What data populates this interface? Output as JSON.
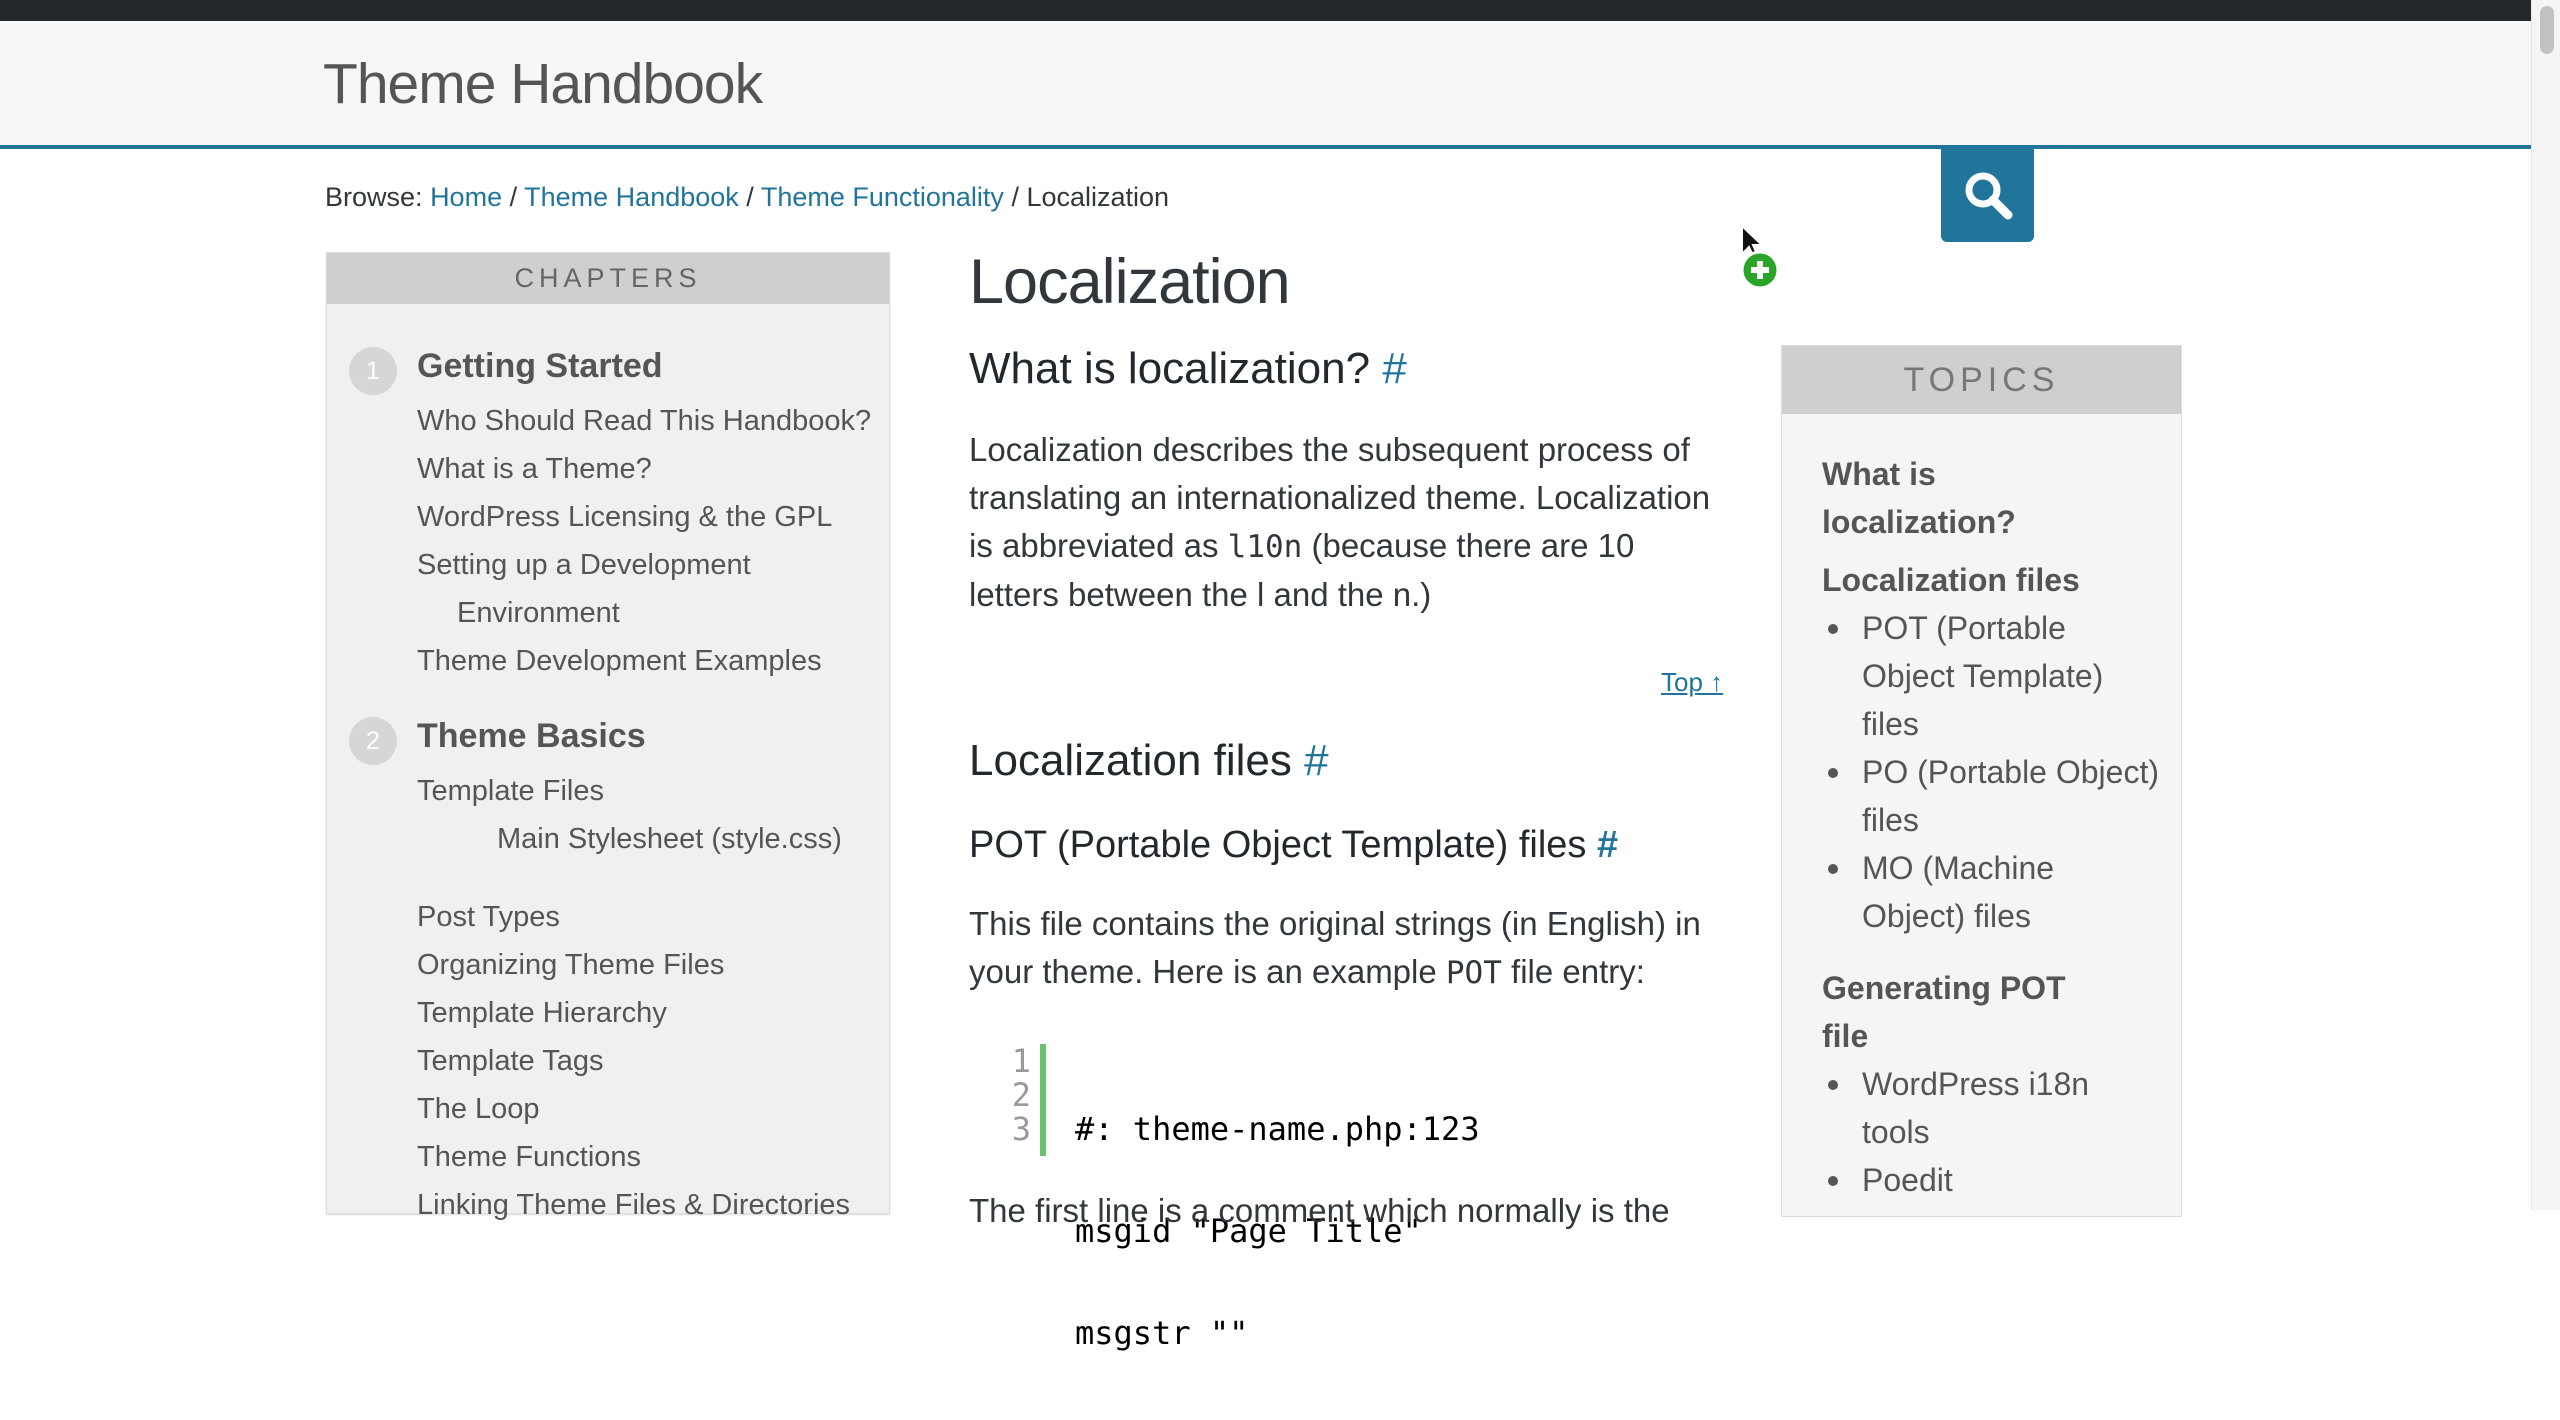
{
  "header": {
    "site_title": "Theme Handbook"
  },
  "breadcrumb": {
    "prefix": "Browse:",
    "items": [
      {
        "label": "Home"
      },
      {
        "label": "Theme Handbook"
      },
      {
        "label": "Theme Functionality"
      }
    ],
    "current": "Localization",
    "separator": "/"
  },
  "search": {
    "icon": "search-icon"
  },
  "chapters": {
    "heading": "CHAPTERS",
    "groups": [
      {
        "num": "1",
        "title": "Getting Started",
        "items": [
          "Who Should Read This Handbook?",
          "What is a Theme?",
          "WordPress Licensing & the GPL",
          "Setting up a Development",
          "Environment",
          "Theme Development Examples"
        ]
      },
      {
        "num": "2",
        "title": "Theme Basics",
        "items": [
          "Template Files",
          "Main Stylesheet (style.css)",
          "Post Types",
          "Organizing Theme Files",
          "Template Hierarchy",
          "Template Tags",
          "The Loop",
          "Theme Functions",
          "Linking Theme Files & Directories"
        ]
      }
    ]
  },
  "article": {
    "title": "Localization",
    "anchor": "#",
    "s1": {
      "heading": "What is localization?",
      "p1": "Localization describes the subsequent process of translating an internationalized theme. Localization is abbreviated as ",
      "code": "l10n",
      "p2": " (because there are 10 letters between the l and the n.)"
    },
    "top_link": "Top ↑",
    "s2": {
      "heading": "Localization files"
    },
    "s3": {
      "heading": "POT (Portable Object Template) files",
      "p1": "This file contains the original strings (in English) in your theme. Here is an example ",
      "code": "POT",
      "p2": " file entry:"
    },
    "code_block": {
      "line_numbers": [
        "1",
        "2",
        "3"
      ],
      "lines": [
        "#: theme-name.php:123",
        "msgid \"Page Title\"",
        "msgstr \"\""
      ]
    },
    "cut_text": "The first line is a comment which normally is the"
  },
  "topics": {
    "heading": "TOPICS",
    "t1": "What is localization?",
    "t2": "Localization files",
    "t2_items": [
      "POT (Portable Object Template) files",
      "PO (Portable Object) files",
      "MO (Machine Object) files"
    ],
    "t3": "Generating POT file",
    "t3_items": [
      "WordPress i18n tools",
      "Poedit"
    ]
  },
  "colors": {
    "link": "#21759b",
    "accent_border": "#21759b",
    "code_bar": "#6ac36a",
    "sidebar_bg": "#f0f0f0",
    "sidebar_head": "#cfcfcf",
    "topbar": "#23282d"
  }
}
